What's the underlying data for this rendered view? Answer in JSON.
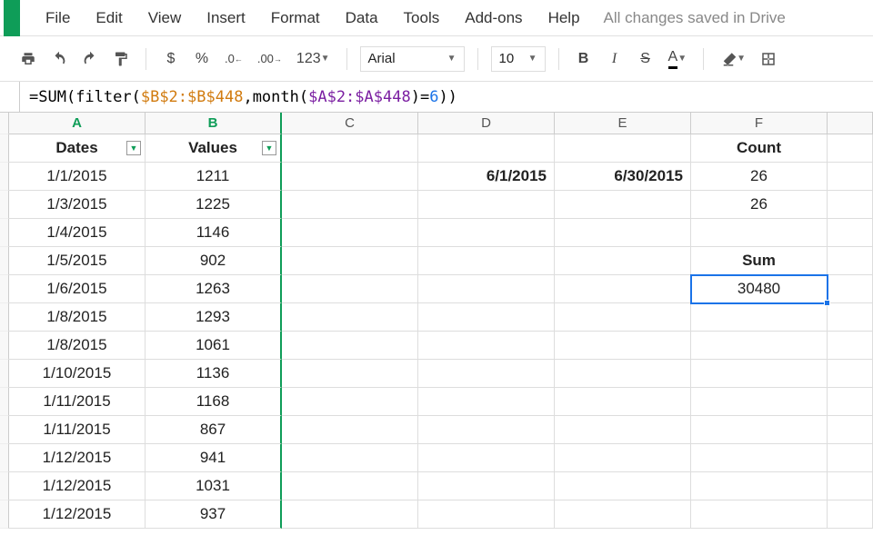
{
  "menus": [
    "File",
    "Edit",
    "View",
    "Insert",
    "Format",
    "Data",
    "Tools",
    "Add-ons",
    "Help"
  ],
  "save_status": "All changes saved in Drive",
  "toolbar": {
    "currency": "$",
    "percent": "%",
    "dec_dec": ".0",
    "inc_dec": ".00",
    "num_format": "123",
    "font": "Arial",
    "size": "10",
    "bold": "B",
    "italic": "I",
    "strike": "S",
    "text_color": "A"
  },
  "formula": {
    "p1": "=SUM(",
    "p2": "filter(",
    "r1": "$B$2:$B$448",
    "p3": ",",
    "p4": "month(",
    "r2": "$A$2:$A$448",
    "p5": ")=",
    "n1": "6",
    "p6": "))"
  },
  "columns": [
    "A",
    "B",
    "C",
    "D",
    "E",
    "F"
  ],
  "headers": {
    "dates": "Dates",
    "values": "Values",
    "count": "Count",
    "sum": "Sum"
  },
  "rows": [
    {
      "a": "1/1/2015",
      "b": "1211",
      "d": "6/1/2015",
      "e": "6/30/2015",
      "f": "26"
    },
    {
      "a": "1/3/2015",
      "b": "1225",
      "f": "26"
    },
    {
      "a": "1/4/2015",
      "b": "1146"
    },
    {
      "a": "1/5/2015",
      "b": "902",
      "f": "Sum",
      "f_bold": true
    },
    {
      "a": "1/6/2015",
      "b": "1263",
      "f": "30480",
      "f_selected": true
    },
    {
      "a": "1/8/2015",
      "b": "1293"
    },
    {
      "a": "1/8/2015",
      "b": "1061"
    },
    {
      "a": "1/10/2015",
      "b": "1136"
    },
    {
      "a": "1/11/2015",
      "b": "1168"
    },
    {
      "a": "1/11/2015",
      "b": "867"
    },
    {
      "a": "1/12/2015",
      "b": "941"
    },
    {
      "a": "1/12/2015",
      "b": "1031"
    },
    {
      "a": "1/12/2015",
      "b": "937"
    }
  ]
}
